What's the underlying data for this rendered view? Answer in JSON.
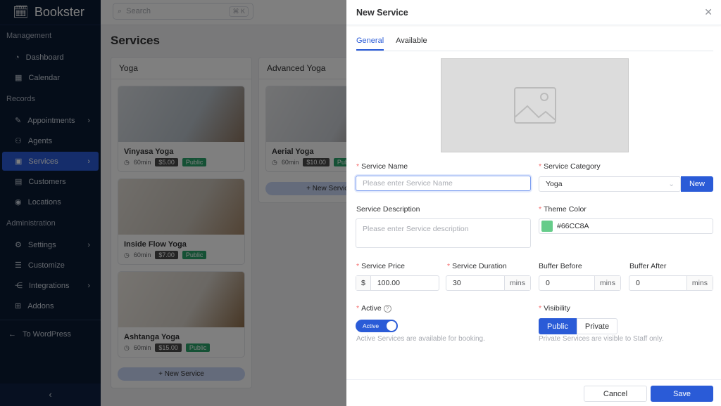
{
  "app": {
    "name": "Bookster"
  },
  "sidebar": {
    "sections": [
      {
        "title": "Management",
        "items": [
          {
            "label": "Dashboard",
            "icon": "dashboard-icon"
          },
          {
            "label": "Calendar",
            "icon": "calendar-icon"
          }
        ]
      },
      {
        "title": "Records",
        "items": [
          {
            "label": "Appointments",
            "icon": "appointments-icon",
            "chevron": true
          },
          {
            "label": "Agents",
            "icon": "agents-icon"
          },
          {
            "label": "Services",
            "icon": "services-icon",
            "chevron": true,
            "active": true
          },
          {
            "label": "Customers",
            "icon": "customers-icon"
          },
          {
            "label": "Locations",
            "icon": "location-icon"
          }
        ]
      },
      {
        "title": "Administration",
        "items": [
          {
            "label": "Settings",
            "icon": "gear-icon",
            "chevron": true
          },
          {
            "label": "Customize",
            "icon": "sliders-icon"
          },
          {
            "label": "Integrations",
            "icon": "share-icon",
            "chevron": true
          },
          {
            "label": "Addons",
            "icon": "addons-icon"
          }
        ]
      }
    ],
    "to_wordpress": "To WordPress"
  },
  "topbar": {
    "search_placeholder": "Search",
    "shortcut": "⌘ K"
  },
  "page": {
    "title": "Services",
    "columns": [
      {
        "title": "Yoga",
        "services": [
          {
            "name": "Vinyasa Yoga",
            "duration": "60min",
            "price": "$5.00",
            "visibility": "Public"
          },
          {
            "name": "Inside Flow Yoga",
            "duration": "60min",
            "price": "$7.00",
            "visibility": "Public"
          },
          {
            "name": "Ashtanga Yoga",
            "duration": "60min",
            "price": "$15.00",
            "visibility": "Public"
          }
        ],
        "new_label": "New Service"
      },
      {
        "title": "Advanced Yoga",
        "services": [
          {
            "name": "Aerial Yoga",
            "duration": "60min",
            "price": "$10.00",
            "visibility": "Public"
          }
        ],
        "new_label": "New Service"
      }
    ]
  },
  "drawer": {
    "title": "New Service",
    "tabs": [
      "General",
      "Available"
    ],
    "service_name": {
      "label": "Service Name",
      "placeholder": "Please enter Service Name"
    },
    "service_category": {
      "label": "Service Category",
      "value": "Yoga",
      "new_label": "New"
    },
    "description": {
      "label": "Service Description",
      "placeholder": "Please enter Service description"
    },
    "theme_color": {
      "label": "Theme Color",
      "value": "#66CC8A"
    },
    "price": {
      "label": "Service Price",
      "prefix": "$",
      "value": "100.00"
    },
    "duration": {
      "label": "Service Duration",
      "value": "30",
      "suffix": "mins"
    },
    "buffer_before": {
      "label": "Buffer Before",
      "value": "0",
      "suffix": "mins"
    },
    "buffer_after": {
      "label": "Buffer After",
      "value": "0",
      "suffix": "mins"
    },
    "active": {
      "label": "Active",
      "toggle_label": "Active",
      "on": true,
      "help": "Active Services are available for booking."
    },
    "visibility": {
      "label": "Visibility",
      "options": [
        "Public",
        "Private"
      ],
      "selected": "Public",
      "help": "Private Services are visible to Staff only."
    },
    "cancel_label": "Cancel",
    "save_label": "Save"
  },
  "colors": {
    "accent": "#2a5bd7",
    "sidebar": "#0b1a33",
    "public_badge": "#2aa36b"
  }
}
